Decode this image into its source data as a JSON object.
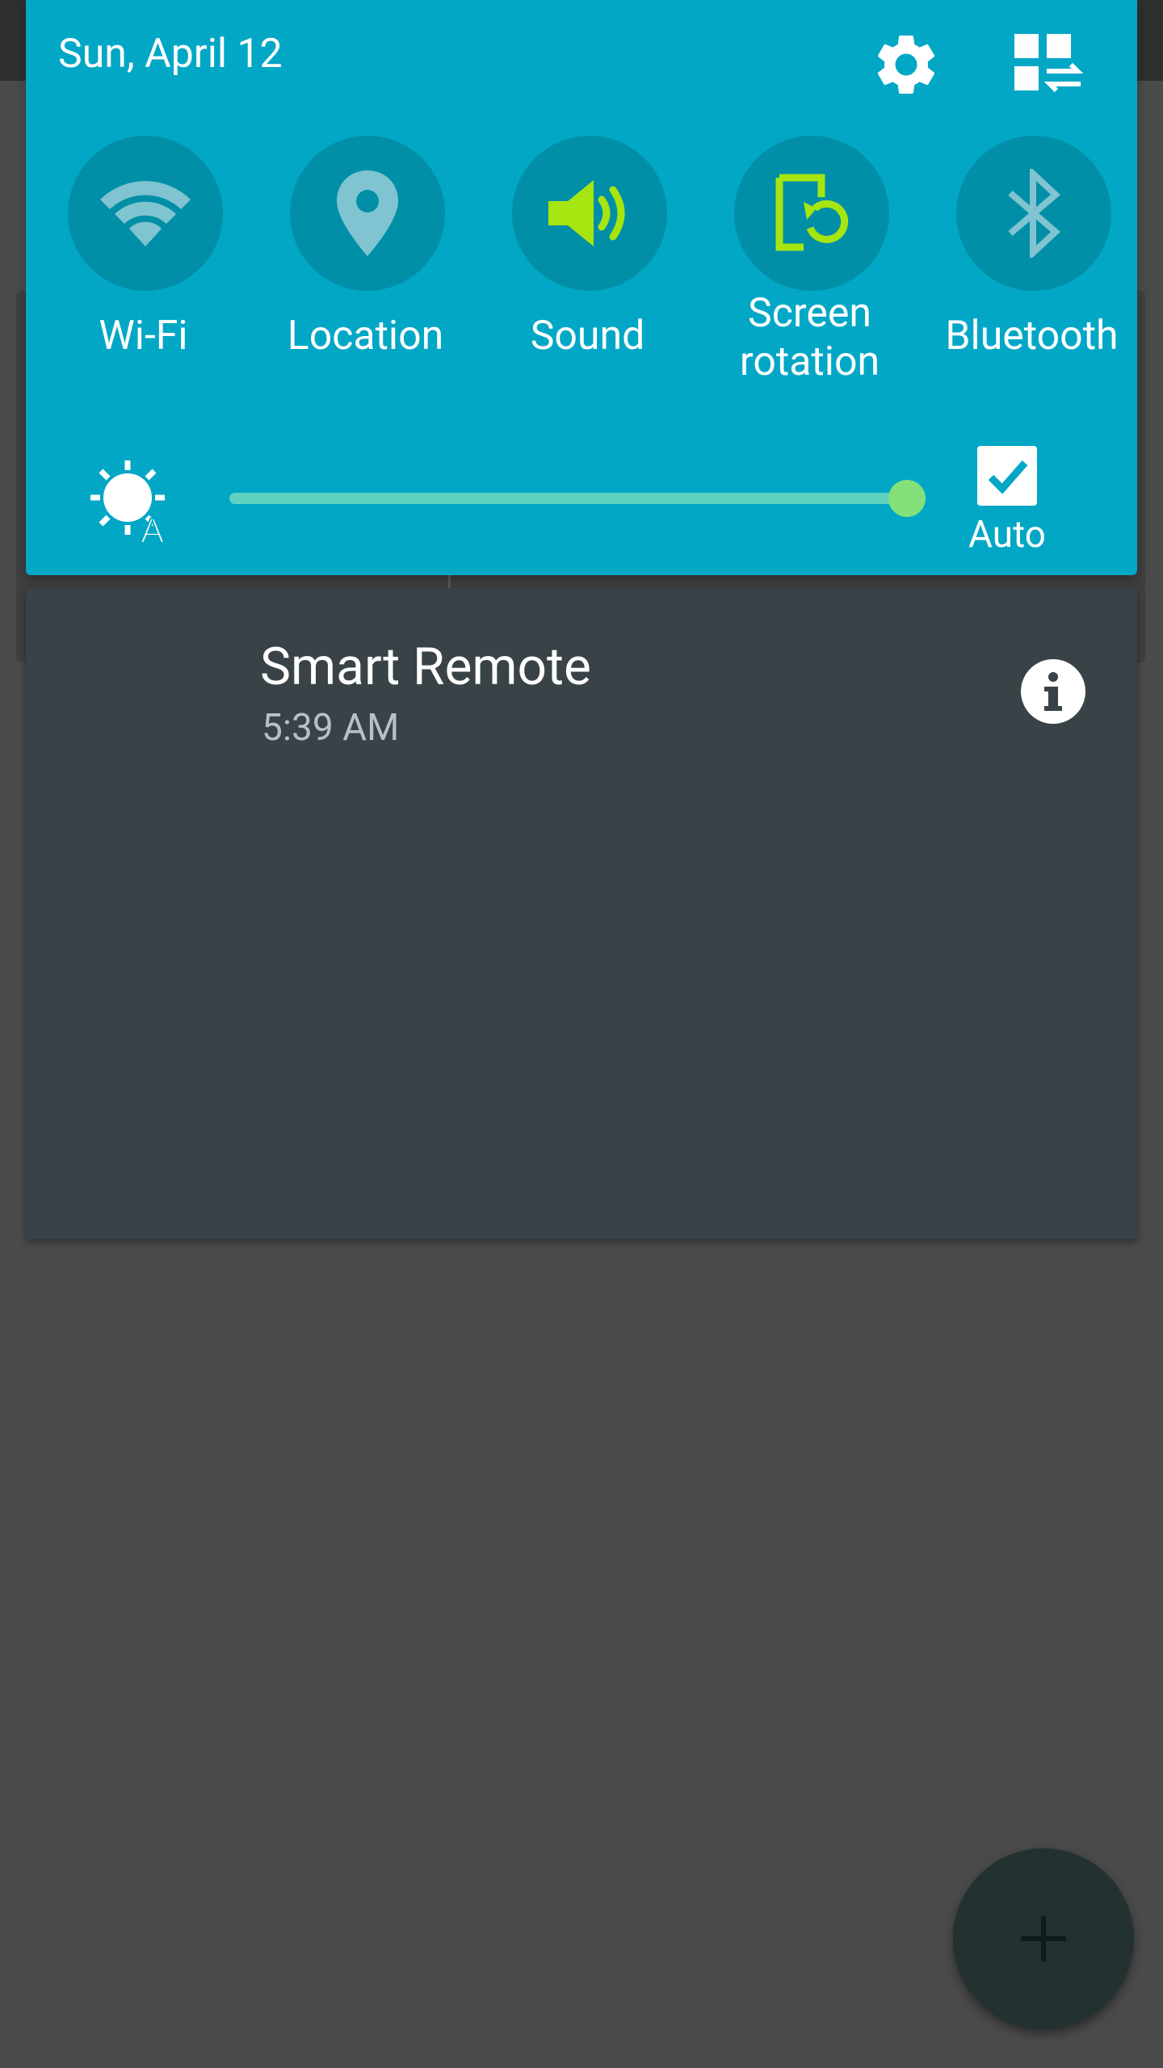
{
  "quick_settings": {
    "date": "Sun, April 12",
    "toggles": [
      {
        "label": "Wi-Fi",
        "icon": "wifi-icon",
        "active": false
      },
      {
        "label": "Location",
        "icon": "location-pin-icon",
        "active": false
      },
      {
        "label": "Sound",
        "icon": "speaker-icon",
        "active": true
      },
      {
        "label": "Screen rotation",
        "icon": "screen-rotation-icon",
        "active": true
      },
      {
        "label": "Bluetooth",
        "icon": "bluetooth-icon",
        "active": false
      }
    ],
    "brightness": {
      "level": 1.0,
      "auto_label": "Auto",
      "auto_checked": true
    },
    "colors": {
      "shade_bg": "#02a7c6",
      "tile_bg": "#018fa8",
      "active_icon": "#a6e50f",
      "inactive_icon": "#7fc4d0",
      "slider_track": "#5fd2bf",
      "slider_thumb": "#84e07a"
    }
  },
  "notification": {
    "title": "Smart Remote",
    "time": "5:39 AM",
    "info_icon": "info-icon"
  },
  "fab": {
    "icon": "plus-icon"
  }
}
